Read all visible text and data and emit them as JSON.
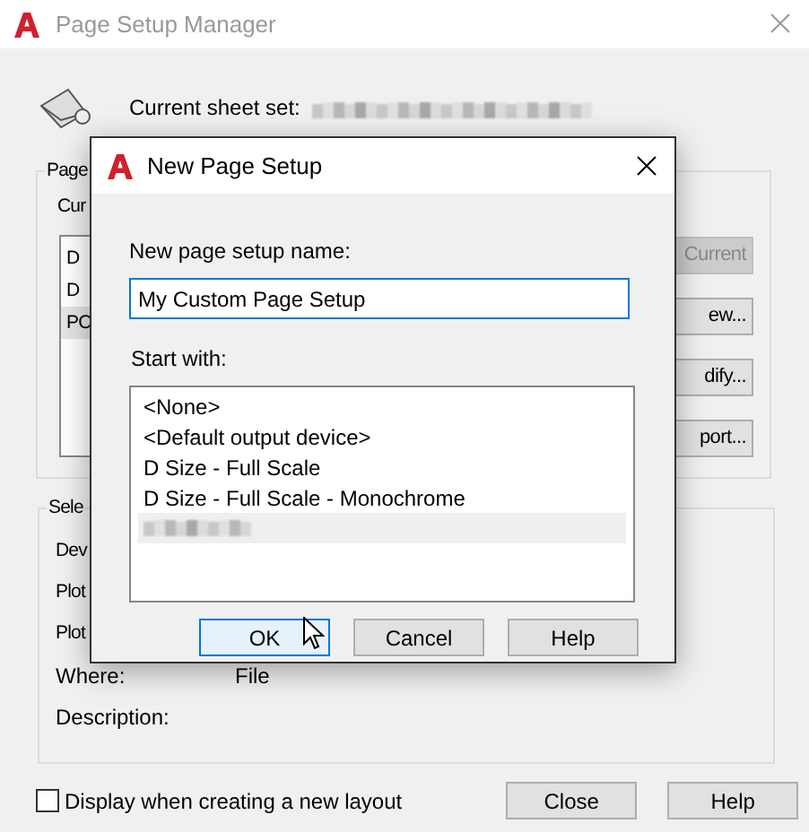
{
  "window": {
    "title": "Page Setup Manager"
  },
  "sheet_set": {
    "label": "Current sheet set:"
  },
  "page_setups_group": {
    "legend": "Page",
    "current_label": "Cur",
    "items": [
      {
        "text": "D",
        "selected": false
      },
      {
        "text": "D",
        "selected": false
      },
      {
        "text": "PC",
        "selected": true
      }
    ],
    "buttons": [
      {
        "label": "Current",
        "disabled": true
      },
      {
        "label": "ew...",
        "disabled": false
      },
      {
        "label": "dify...",
        "disabled": false
      },
      {
        "label": "port...",
        "disabled": false
      }
    ]
  },
  "details_group": {
    "legend": "Sele",
    "rows": [
      {
        "label": "Dev"
      },
      {
        "label": "Plot"
      },
      {
        "label": "Plot"
      },
      {
        "label": "Where:",
        "value": "File"
      },
      {
        "label": "Description:"
      }
    ]
  },
  "display_checkbox": {
    "label": "Display when creating a new layout",
    "checked": false
  },
  "footer_buttons": [
    "Close",
    "Help"
  ],
  "dialog": {
    "title": "New Page Setup",
    "name_label": "New page setup name:",
    "name_value": "My Custom Page Setup",
    "start_label": "Start with:",
    "items": [
      {
        "kind": "text",
        "text": "<None>",
        "selected": false
      },
      {
        "kind": "text",
        "text": "<Default output device>",
        "selected": false
      },
      {
        "kind": "text",
        "text": "D Size - Full Scale",
        "selected": false
      },
      {
        "kind": "text",
        "text": "D Size - Full Scale - Monochrome",
        "selected": false
      },
      {
        "kind": "redacted",
        "selected": true
      }
    ],
    "buttons": [
      {
        "label": "OK",
        "default": true
      },
      {
        "label": "Cancel",
        "default": false
      },
      {
        "label": "Help",
        "default": false
      }
    ]
  }
}
